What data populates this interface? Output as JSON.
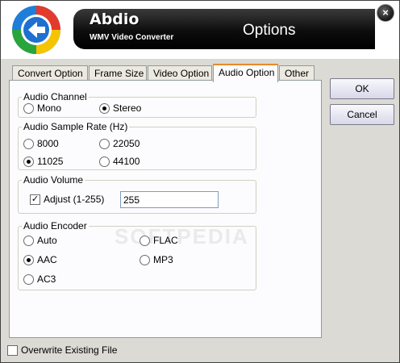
{
  "header": {
    "app_name": "Abdio",
    "app_subtitle": "WMV Video Converter",
    "dialog_title": "Options",
    "close_label": "×"
  },
  "tabs": [
    {
      "label": "Convert Option",
      "active": false
    },
    {
      "label": "Frame Size",
      "active": false
    },
    {
      "label": "Video Option",
      "active": false
    },
    {
      "label": "Audio Option",
      "active": true
    },
    {
      "label": "Other",
      "active": false
    }
  ],
  "audio_channel": {
    "title": "Audio Channel",
    "options": [
      {
        "label": "Mono",
        "selected": false
      },
      {
        "label": "Stereo",
        "selected": true
      }
    ]
  },
  "sample_rate": {
    "title": "Audio Sample Rate (Hz)",
    "options": [
      {
        "label": "8000",
        "selected": false
      },
      {
        "label": "22050",
        "selected": false
      },
      {
        "label": "11025",
        "selected": true
      },
      {
        "label": "44100",
        "selected": false
      }
    ]
  },
  "volume": {
    "title": "Audio Volume",
    "adjust_label": "Adjust (1-255)",
    "adjust_checked": true,
    "value": "255"
  },
  "encoder": {
    "title": "Audio Encoder",
    "options": [
      {
        "label": "Auto",
        "selected": false
      },
      {
        "label": "FLAC",
        "selected": false
      },
      {
        "label": "AAC",
        "selected": true
      },
      {
        "label": "MP3",
        "selected": false
      },
      {
        "label": "AC3",
        "selected": false
      }
    ]
  },
  "buttons": {
    "ok": "OK",
    "cancel": "Cancel"
  },
  "overwrite": {
    "label": "Overwrite Existing File",
    "checked": false
  },
  "watermark": "SOFTPEDIA",
  "check_mark": "✓",
  "colors": {
    "active_tab_accent": "#e68b2c",
    "header_bar": "#000000"
  }
}
